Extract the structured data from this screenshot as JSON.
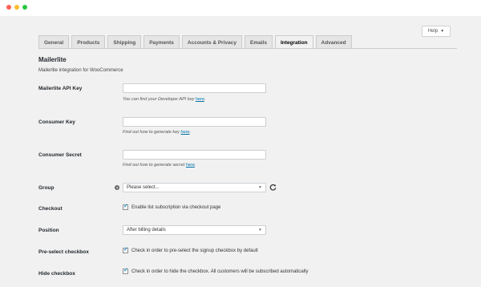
{
  "window": {},
  "help": {
    "label": "Help"
  },
  "tabs": [
    {
      "label": "General"
    },
    {
      "label": "Products"
    },
    {
      "label": "Shipping"
    },
    {
      "label": "Payments"
    },
    {
      "label": "Accounts & Privacy"
    },
    {
      "label": "Emails"
    },
    {
      "label": "Integration",
      "active": true
    },
    {
      "label": "Advanced"
    }
  ],
  "section": {
    "title": "Mailerlite",
    "description": "Mailerlite integration for WooCommerce"
  },
  "fields": {
    "api_key": {
      "label": "Mailerlite API Key",
      "value": "",
      "desc_prefix": "You can find your Developer API key ",
      "desc_link": "here",
      "desc_suffix": "."
    },
    "consumer_key": {
      "label": "Consumer Key",
      "value": "",
      "desc_prefix": "Find out how to generate key ",
      "desc_link": "here",
      "desc_suffix": "."
    },
    "consumer_secret": {
      "label": "Consumer Secret",
      "value": "",
      "desc_prefix": "Find out how to generate secret ",
      "desc_link": "here",
      "desc_suffix": "."
    },
    "group": {
      "label": "Group",
      "selected": "Please select..."
    },
    "checkout": {
      "label": "Checkout",
      "checkbox_label": "Enable list subscription via checkout page",
      "checked": true
    },
    "position": {
      "label": "Position",
      "selected": "After billing details"
    },
    "preselect": {
      "label": "Pre-select checkbox",
      "checkbox_label": "Check in order to pre-select the signup checkbox by default",
      "checked": true
    },
    "hide": {
      "label": "Hide checkbox",
      "checkbox_label": "Check in order to hide the checkbox. All customers will be subscribed automatically",
      "checked": true
    }
  },
  "colors": {
    "background": "#f1f1f1",
    "link": "#0073aa",
    "checkmark": "#1e8cbe"
  }
}
